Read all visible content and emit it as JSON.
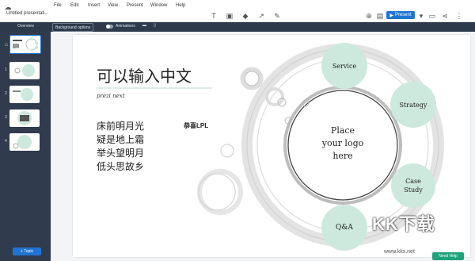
{
  "app": {
    "file_title": "Untitled presentati...",
    "menu": [
      "File",
      "Edit",
      "Insert",
      "View",
      "Present",
      "Window",
      "Help"
    ],
    "present_label": "Present"
  },
  "toolbar": {
    "overview_label": "Overview",
    "background_options_label": "Background options",
    "animations_label": "Animations"
  },
  "sidebar": {
    "overview_thumb_label": "Overview",
    "slides": [
      {
        "num": "1"
      },
      {
        "num": "2"
      },
      {
        "num": "3"
      },
      {
        "num": "4"
      }
    ],
    "add_topic_label": "+ Topic"
  },
  "slide": {
    "title": "可以输入中文",
    "subtitle": "prezi next",
    "poem": [
      "床前明月光",
      "疑是地上霜",
      "举头望明月",
      "低头思故乡"
    ],
    "congrats": "恭喜LPL",
    "center_lines": [
      "Place",
      "your logo",
      "here"
    ],
    "bubbles": {
      "service": "Service",
      "strategy": "Strategy",
      "case_study": [
        "Case",
        "Study"
      ],
      "qa": "Q&A"
    },
    "bubble_color": "#cde9dd"
  },
  "overlay": {
    "watermark": "KK下载",
    "watermark_url": "www.kkx.net",
    "need_help_label": "Need Help"
  },
  "colors": {
    "accent_blue": "#1f74d3",
    "sidebar_bg": "#303c4d",
    "need_help_green": "#1fa37c"
  }
}
